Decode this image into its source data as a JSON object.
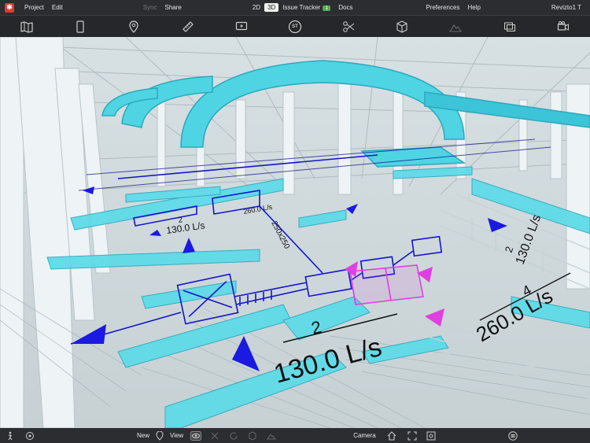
{
  "menubar": {
    "logo": "✱",
    "project": "Project",
    "edit": "Edit",
    "sync": "Sync",
    "share": "Share",
    "view2d": "2D",
    "view3d": "3D",
    "issue_tracker": "Issue Tracker",
    "issue_count": "1",
    "docs": "Docs",
    "preferences": "Preferences",
    "help": "Help",
    "user": "Revizto1 T"
  },
  "toolbar": {
    "icons": [
      "map-icon",
      "tablet-icon",
      "pin-icon",
      "ruler-icon",
      "comment-icon",
      "st-icon",
      "scissors-icon",
      "cube-icon",
      "terrain-icon",
      "layers-icon",
      "camera-icon"
    ],
    "st_label": "ST"
  },
  "viewport": {
    "labels": {
      "flow_main_num": "2",
      "flow_main": "130.0 L/s",
      "flow_right_num": "4",
      "flow_right": "260.0 L/s",
      "flow_left_num": "2",
      "flow_left": "130.0 L/s",
      "flow_far": "260.0 L/s",
      "flow_edge_num": "2",
      "flow_edge": "130.0 L/s",
      "duct_tag": "250x250"
    },
    "colors": {
      "duct": "#4fd4e4",
      "duct_dark": "#2aa9bd",
      "annotation": "#1414cc",
      "selection": "#e040e0",
      "pipe": "#eef3f5"
    }
  },
  "bottombar": {
    "new": "New",
    "view": "View",
    "camera": "Camera"
  }
}
